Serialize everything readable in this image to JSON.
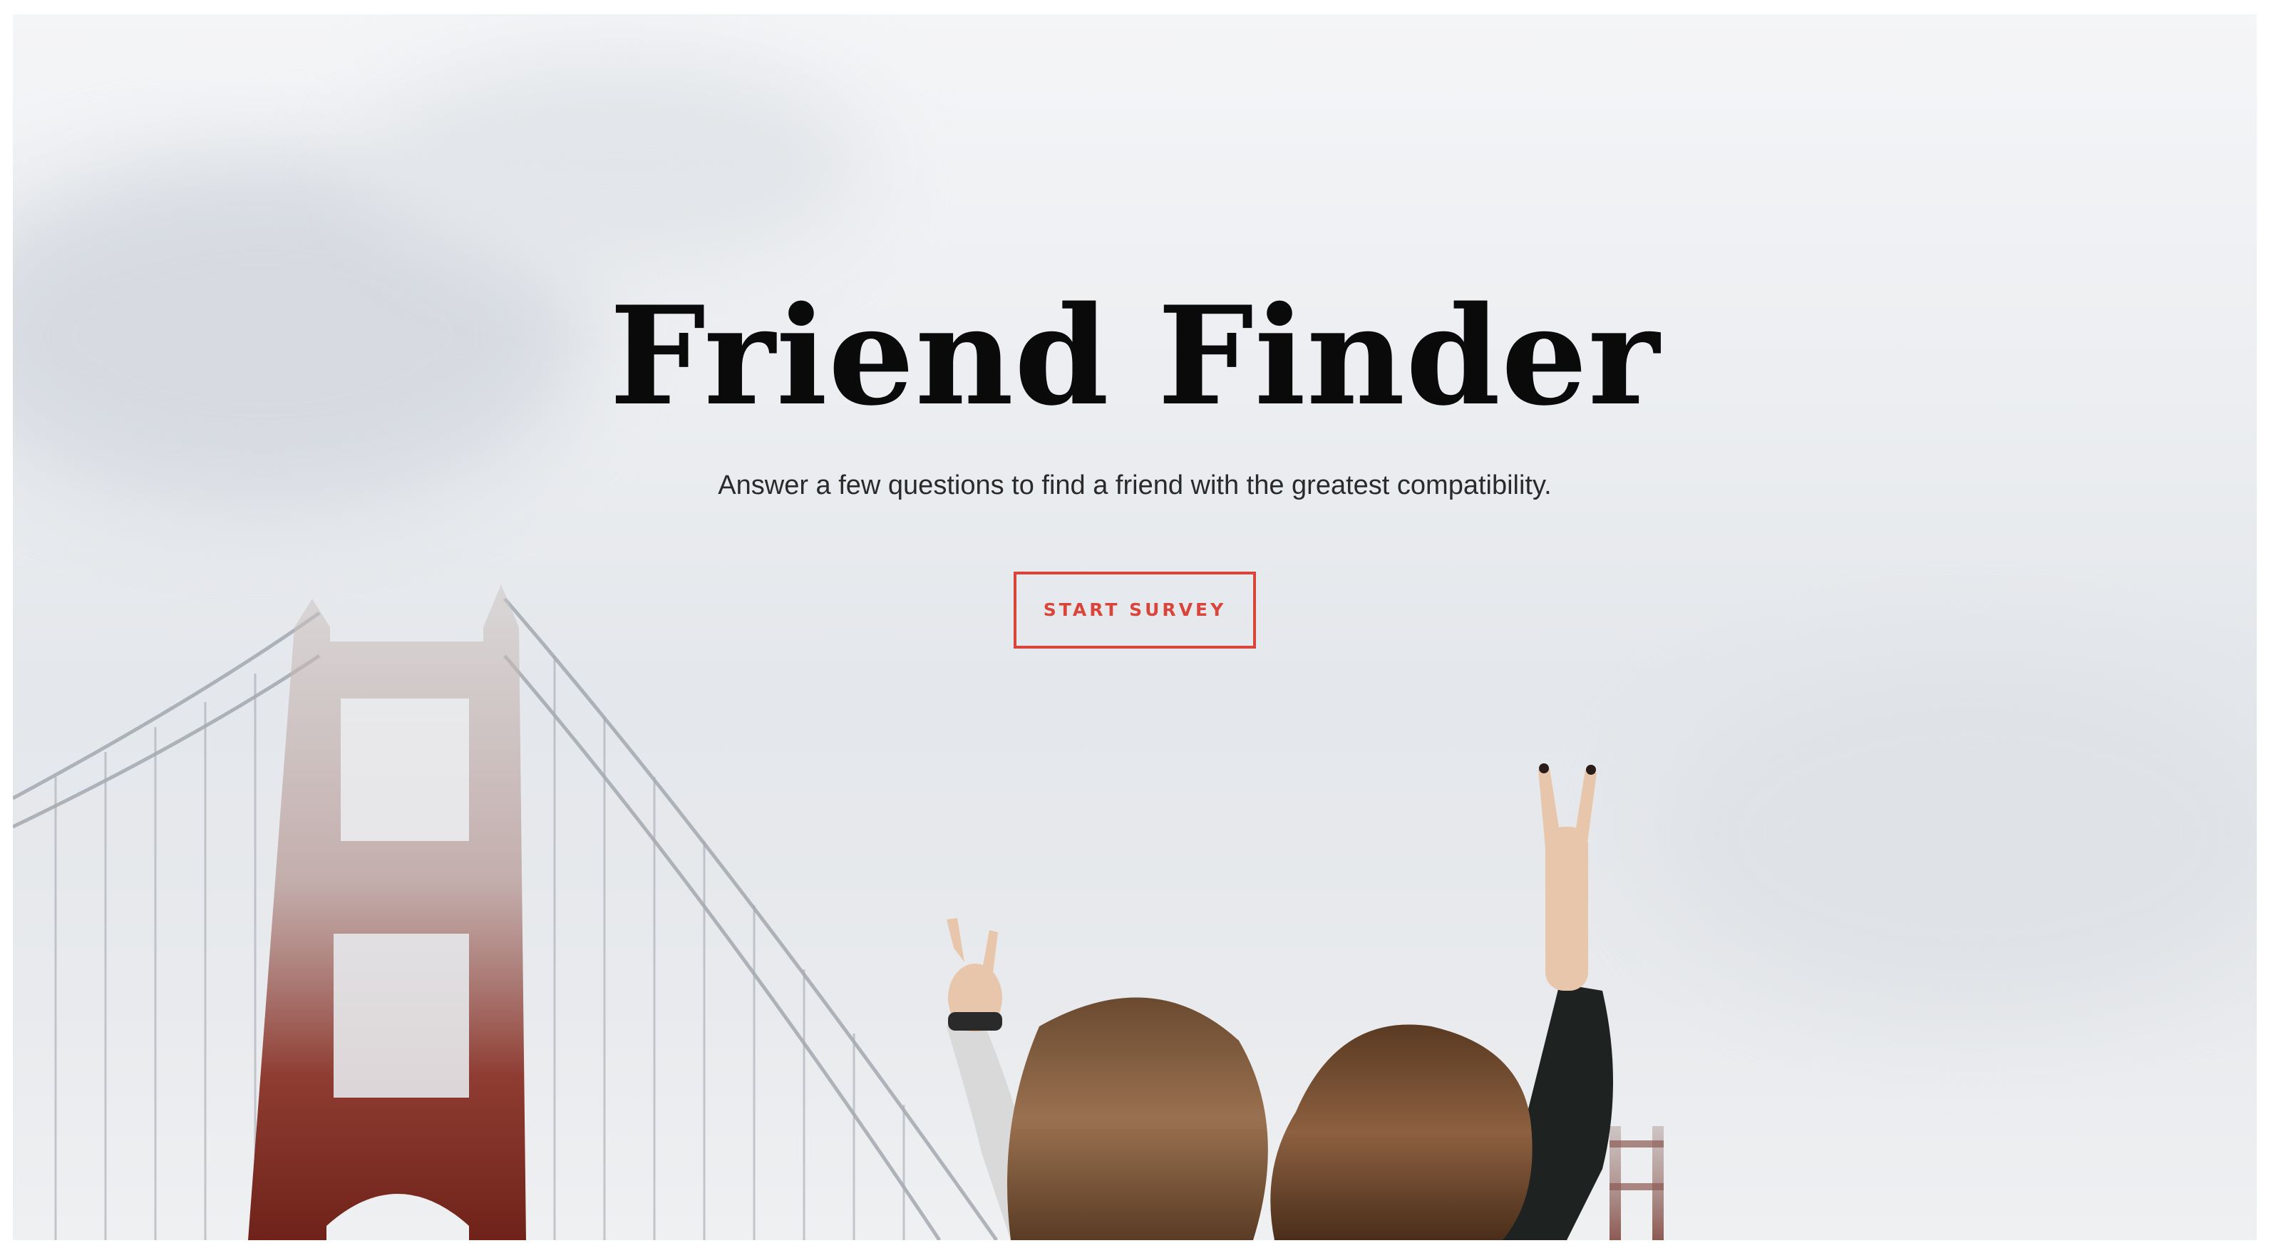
{
  "hero": {
    "title": "Friend Finder",
    "subtitle": "Answer a few questions to find a friend with the greatest compatibility.",
    "cta_label": "START SURVEY"
  },
  "colors": {
    "accent": "#d9453a",
    "title": "#0a0a0a",
    "bridge": "#8a3328",
    "sky": "#e6e8eb"
  },
  "background": {
    "image_subject": "golden-gate-bridge-two-friends-peace-sign"
  }
}
